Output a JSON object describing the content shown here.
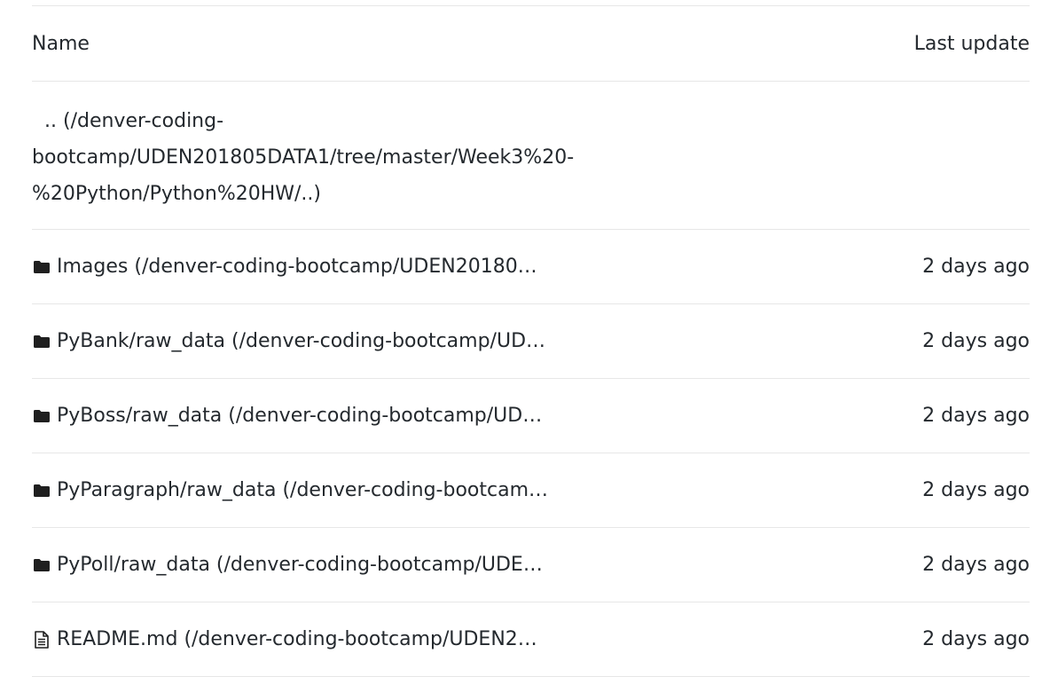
{
  "header": {
    "name_label": "Name",
    "update_label": "Last update"
  },
  "parent": {
    "text": ".. (/denver-coding-bootcamp/UDEN201805DATA1/tree/master/Week3%20-%20Python/Python%20HW/..)"
  },
  "items": [
    {
      "icon": "folder-icon",
      "name": "Images (/denver-coding-bootcamp/UDEN20180…",
      "updated": "2 days ago"
    },
    {
      "icon": "folder-icon",
      "name": "PyBank/raw_data (/denver-coding-bootcamp/UD…",
      "updated": "2 days ago"
    },
    {
      "icon": "folder-icon",
      "name": "PyBoss/raw_data (/denver-coding-bootcamp/UD…",
      "updated": "2 days ago"
    },
    {
      "icon": "folder-icon",
      "name": "PyParagraph/raw_data (/denver-coding-bootcam…",
      "updated": "2 days ago"
    },
    {
      "icon": "folder-icon",
      "name": "PyPoll/raw_data (/denver-coding-bootcamp/UDE…",
      "updated": "2 days ago"
    },
    {
      "icon": "file-text-icon",
      "name": "README.md (/denver-coding-bootcamp/UDEN2…",
      "updated": "2 days ago"
    }
  ]
}
